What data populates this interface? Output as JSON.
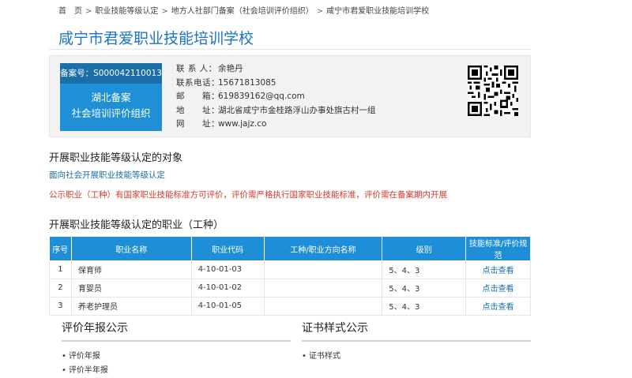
{
  "breadcrumb": {
    "items": [
      "首　页",
      "职业技能等级认定",
      "地方人社部门备案（社会培训评价组织）",
      "咸宁市君爱职业技能培训学校"
    ],
    "separator": ">"
  },
  "title": "咸宁市君爱职业技能培训学校",
  "registration": {
    "number": "备案号：S000042110013",
    "org_line1": "湖北备案",
    "org_line2": "社会培训评价组织"
  },
  "contacts": [
    {
      "label": "联 系 人：",
      "value": "余艳丹"
    },
    {
      "label": "联系电话：",
      "value": "15671813085"
    },
    {
      "label": "邮　　箱：",
      "value": "619839162@qq.com"
    },
    {
      "label": "地　　址：",
      "value": "湖北省咸宁市金桂路浮山办事处旗古村一组"
    },
    {
      "label": "网　　址：",
      "value": "www.jajz.co"
    }
  ],
  "section_target": {
    "title": "开展职业技能等级认定的对象",
    "audience": "面向社会开展职业技能等级认定",
    "notice": "公示职业（工种）有国家职业技能标准方可评价，评价需严格执行国家职业技能标准，评价需在备案期内开展"
  },
  "section_jobs": {
    "title": "开展职业技能等级认定的职业（工种）",
    "headers": [
      "序号",
      "职业名称",
      "职业代码",
      "工种/职业方向名称",
      "级别",
      "技能标准/评价规范"
    ],
    "rows": [
      {
        "no": "1",
        "name": "保育师",
        "code": "4-10-01-03",
        "direction": "",
        "level": "5、4、3",
        "link": "点击查看"
      },
      {
        "no": "2",
        "name": "育婴员",
        "code": "4-10-01-02",
        "direction": "",
        "level": "5、4、3",
        "link": "点击查看"
      },
      {
        "no": "3",
        "name": "养老护理员",
        "code": "4-10-01-05",
        "direction": "",
        "level": "5、4、3",
        "link": "点击查看"
      }
    ]
  },
  "panel_annual": {
    "title": "评价年报公示",
    "items": [
      "评价年报",
      "评价半年报"
    ]
  },
  "panel_cert": {
    "title": "证书样式公示",
    "items": [
      "证书样式"
    ]
  },
  "colors": {
    "accent": "#1e8ed6",
    "title": "#1a73c6",
    "notice": "#d43a2a"
  },
  "icons": {
    "qr": "qr-code-image"
  }
}
